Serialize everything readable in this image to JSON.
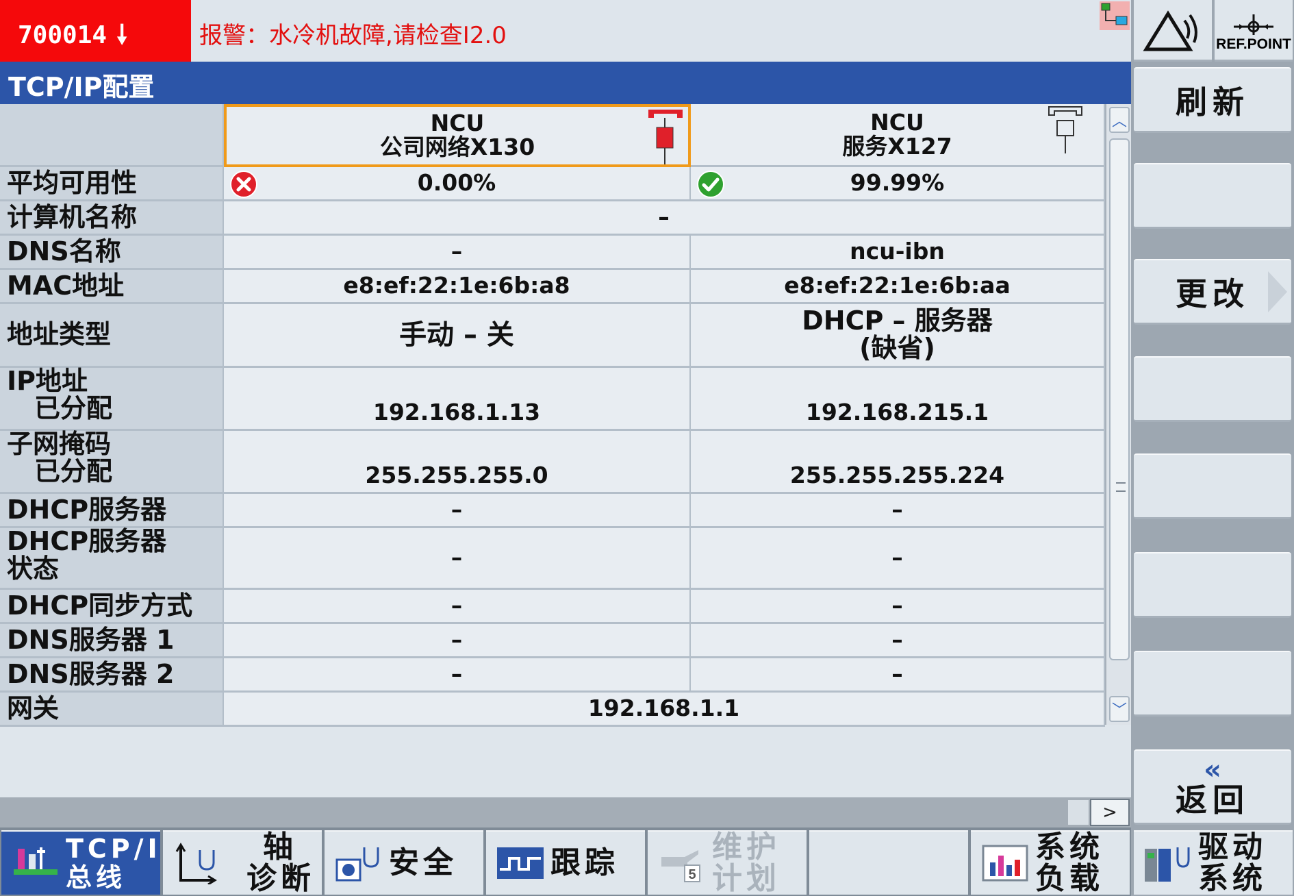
{
  "header": {
    "alarm_code": "700014",
    "alarm_message": "报警：水冷机故障,请检查I2.0"
  },
  "title": "TCP/IP配置",
  "table": {
    "columns": [
      {
        "line1": "NCU",
        "line2": "公司网络X130"
      },
      {
        "line1": "NCU",
        "line2": "服务X127"
      }
    ],
    "rows": [
      {
        "label": "平均可用性",
        "a": "0.00%",
        "b": "99.99%"
      },
      {
        "label": "计算机名称",
        "merged": "–"
      },
      {
        "label": "DNS名称",
        "a": "–",
        "b": "ncu-ibn"
      },
      {
        "label": "MAC地址",
        "a": "e8:ef:22:1e:6b:a8",
        "b": "e8:ef:22:1e:6b:aa"
      },
      {
        "label": "地址类型",
        "a": "手动 – 关",
        "b1": "DHCP – 服务器",
        "b2": "(缺省)"
      },
      {
        "label1": "IP地址",
        "label2": "已分配",
        "a": "192.168.1.13",
        "b": "192.168.215.1"
      },
      {
        "label1": "子网掩码",
        "label2": "已分配",
        "a": "255.255.255.0",
        "b": "255.255.255.224"
      },
      {
        "label": "DHCP服务器",
        "a": "–",
        "b": "–"
      },
      {
        "label1": "DHCP服务器",
        "label2": "状态",
        "a": "–",
        "b": "–"
      },
      {
        "label": "DHCP同步方式",
        "a": "–",
        "b": "–"
      },
      {
        "label": "DNS服务器 1",
        "a": "–",
        "b": "–"
      },
      {
        "label": "DNS服务器 2",
        "a": "–",
        "b": "–"
      },
      {
        "label": "网关",
        "merged": "192.168.1.1"
      }
    ]
  },
  "right_softkeys": {
    "refpoint": "REF.POINT",
    "refresh": "刷新",
    "change": "更改",
    "back": "返回"
  },
  "bottom_softkeys": {
    "tcpip_1": "TCP/IP",
    "tcpip_2": "总线",
    "axis_1": "轴",
    "axis_2": "诊断",
    "safety": "安全",
    "trace": "跟踪",
    "maint_1": "维护",
    "maint_2": "计划",
    "maint_badge": "5",
    "load_1": "系统",
    "load_2": "负载",
    "drive_1": "驱动",
    "drive_2": "系统"
  },
  "colors": {
    "alarm_bg": "#f5090b",
    "alarm_text": "#e3100f",
    "title_bar": "#2c55a8",
    "selected_border": "#f09a1a",
    "ok_green": "#2fa12f",
    "error_red": "#e0202a"
  },
  "icons": [
    "alarm-down-arrow-icon",
    "network-icon",
    "error-icon",
    "ok-icon",
    "interface-plug-icon",
    "wave-icon",
    "refpoint-icon"
  ]
}
